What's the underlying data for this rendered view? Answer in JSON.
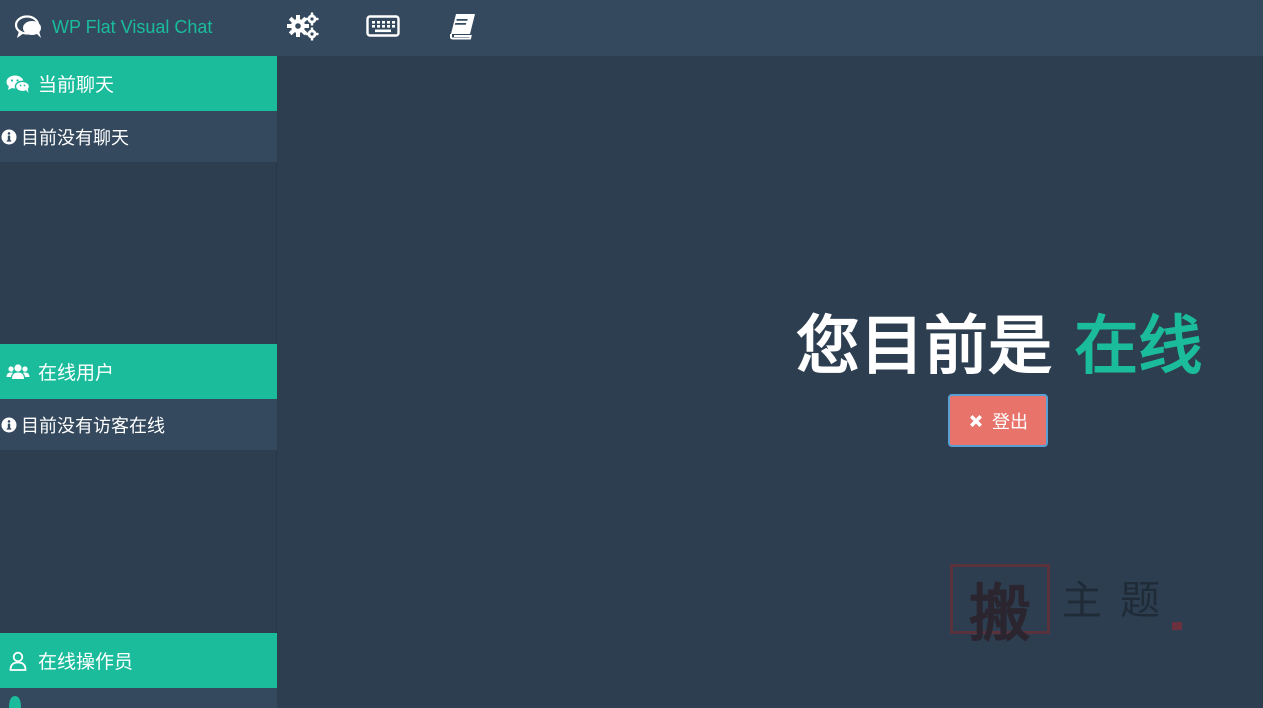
{
  "app": {
    "title": "WP Flat Visual Chat"
  },
  "toolbar": {
    "items": [
      {
        "icon": "gears-icon"
      },
      {
        "icon": "keyboard-icon"
      },
      {
        "icon": "book-icon"
      }
    ]
  },
  "sidebar": {
    "current_chats": {
      "header": "当前聊天",
      "icon": "wechat-icon",
      "empty_message": "目前没有聊天"
    },
    "online_users": {
      "header": "在线用户",
      "icon": "users-icon",
      "empty_message": "目前没有访客在线"
    },
    "online_operators": {
      "header": "在线操作员",
      "icon": "user-icon"
    }
  },
  "main": {
    "status_prefix": "您目前是",
    "status_value": "在线",
    "logout_label": "登出"
  },
  "watermark": {
    "seal_char": "搬",
    "text": "主题"
  },
  "colors": {
    "topbar": "#34495e",
    "background": "#2d3e50",
    "accent": "#1abc9c",
    "danger": "#e8736a"
  }
}
